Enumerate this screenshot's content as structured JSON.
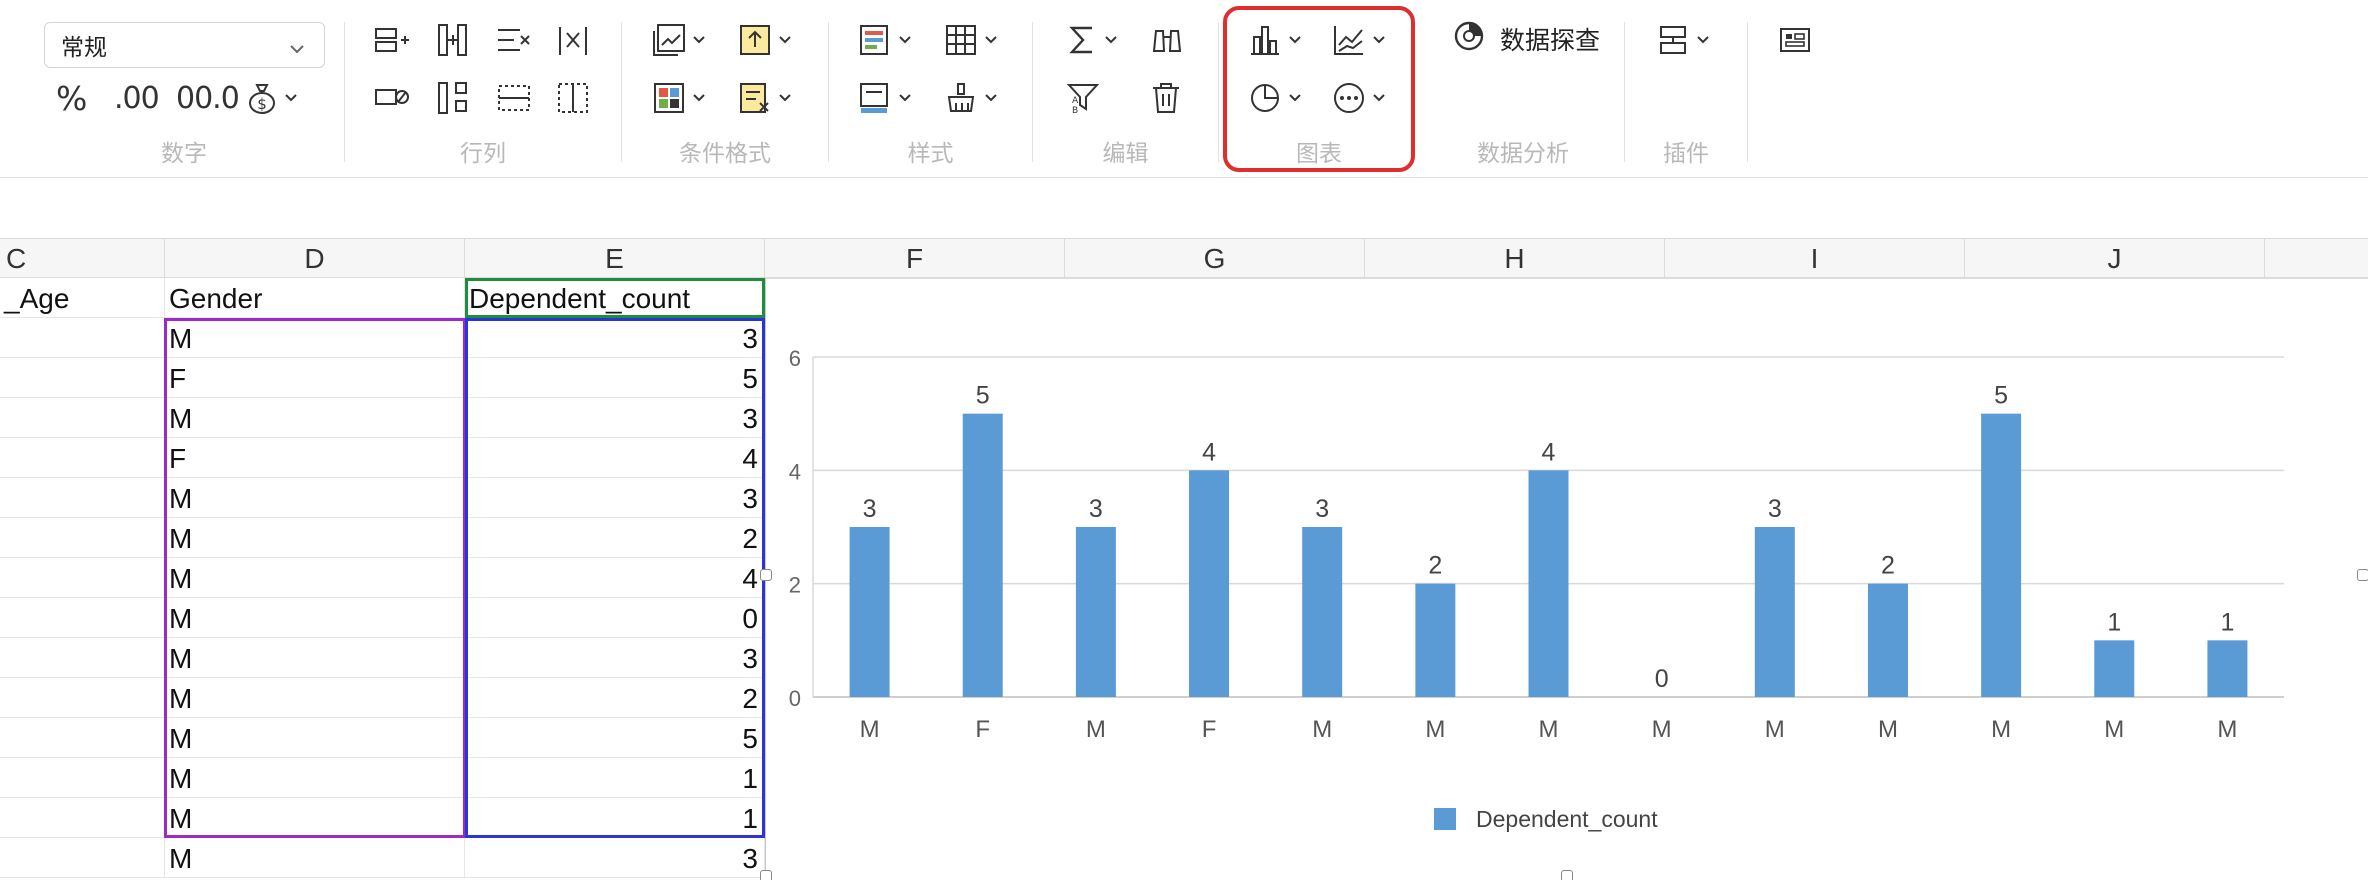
{
  "ribbon": {
    "number_format": "常规",
    "groups": [
      "数字",
      "行列",
      "条件格式",
      "样式",
      "编辑",
      "图表",
      "数据分析",
      "插件"
    ],
    "number_symbols": [
      "%",
      ".00",
      "00.0"
    ],
    "data_explore_label": "数据探查"
  },
  "sheet": {
    "columns": [
      "C",
      "D",
      "E",
      "F",
      "G",
      "H",
      "I",
      "J"
    ],
    "header_row": [
      "_Age",
      "Gender",
      "Dependent_count"
    ],
    "rows": [
      [
        "M",
        "3"
      ],
      [
        "F",
        "5"
      ],
      [
        "M",
        "3"
      ],
      [
        "F",
        "4"
      ],
      [
        "M",
        "3"
      ],
      [
        "M",
        "2"
      ],
      [
        "M",
        "4"
      ],
      [
        "M",
        "0"
      ],
      [
        "M",
        "3"
      ],
      [
        "M",
        "2"
      ],
      [
        "M",
        "5"
      ],
      [
        "M",
        "1"
      ],
      [
        "M",
        "1"
      ],
      [
        "M",
        "3"
      ]
    ]
  },
  "colors": {
    "bar": "#5b9bd5",
    "chart_highlight": "#e02e2e",
    "sel_purple": "#9b2bc8",
    "sel_blue": "#2b35d6",
    "sel_green": "#1e8e3e"
  },
  "chart_data": {
    "type": "bar",
    "categories": [
      "M",
      "F",
      "M",
      "F",
      "M",
      "M",
      "M",
      "M",
      "M",
      "M",
      "M",
      "M",
      "M"
    ],
    "series": [
      {
        "name": "Dependent_count",
        "values": [
          3,
          5,
          3,
          4,
          3,
          2,
          4,
          0,
          3,
          2,
          5,
          1,
          1
        ]
      }
    ],
    "ylim": [
      0,
      6
    ],
    "yticks": [
      0,
      2,
      4,
      6
    ],
    "data_labels": true,
    "grid": true,
    "legend": "bottom"
  }
}
